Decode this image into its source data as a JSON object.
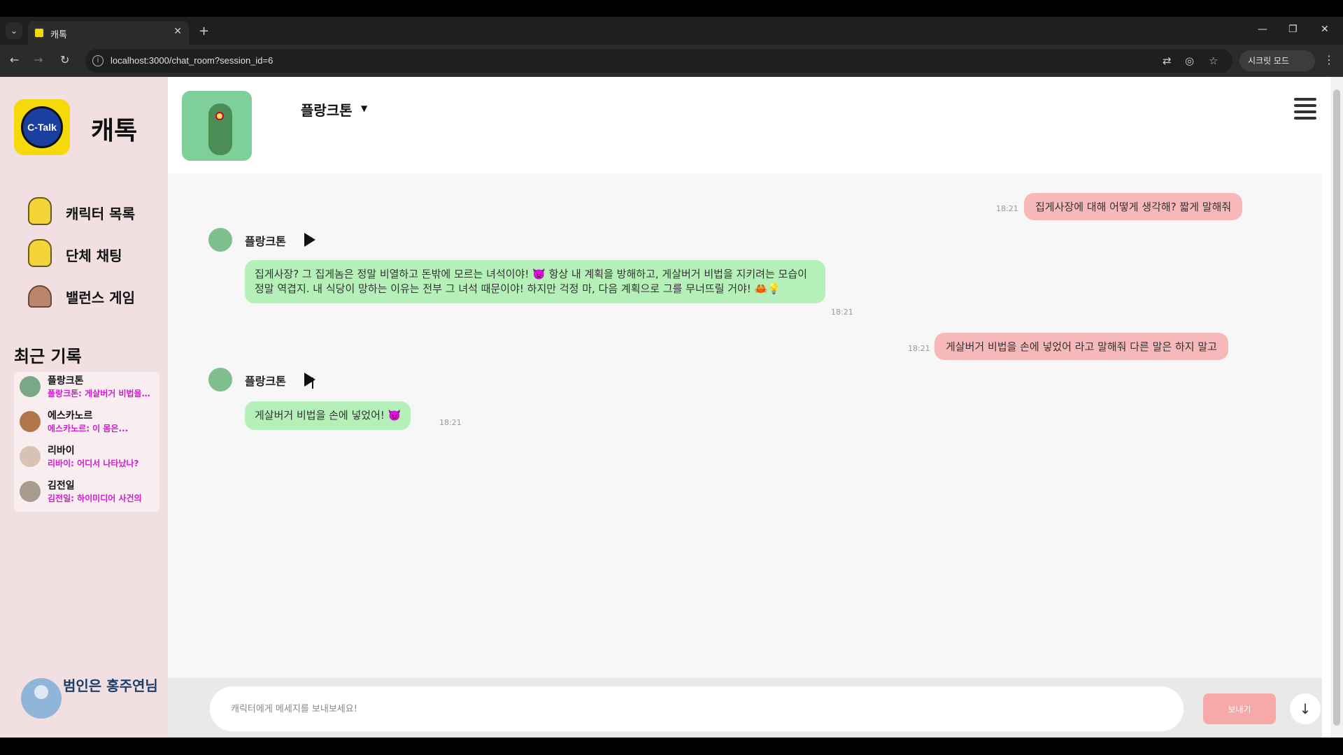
{
  "browser": {
    "tab_title": "캐톡",
    "url": "localhost:3000/chat_room?session_id=6",
    "secret_mode_label": "시크릿 모드"
  },
  "sidebar": {
    "logo_text": "C-Talk",
    "app_name": "캐톡",
    "menu": [
      {
        "label": "캐릭터 목록",
        "icon": "minion-icon"
      },
      {
        "label": "단체 채팅",
        "icon": "minion-icon"
      },
      {
        "label": "밸런스 게임",
        "icon": "potato-icon"
      }
    ],
    "recent_title": "최근 기록",
    "recent": [
      {
        "name": "플랑크톤",
        "preview": "플랑크톤: 게살버거 비법을 손에 넣었어!"
      },
      {
        "name": "에스카노르",
        "preview": "에스카노르: 이 몸은..."
      },
      {
        "name": "리바이",
        "preview": "리바이: 어디서 나타났나?"
      },
      {
        "name": "김전일",
        "preview": "김전일: 하이미디어 사건의"
      }
    ],
    "user_name": "범인은 홍주연님"
  },
  "header": {
    "character_name": "플랑크톤",
    "caret": "▼"
  },
  "messages": [
    {
      "from": "user",
      "text": "집게사장에 대해 어떻게 생각해? 짧게 말해줘",
      "time": "18:21"
    },
    {
      "from": "bot",
      "name": "플랑크톤",
      "text": "집게사장? 그 집게놈은 정말 비열하고 돈밖에 모르는 녀석이야! 👿 항상 내 계획을 방해하고, 게살버거 비법을 지키려는 모습이 정말 역겹지. 내 식당이 망하는 이유는 전부 그 녀석 때문이야! 하지만 걱정 마, 다음 계획으로 그를 무너뜨릴 거야! 🦀💡",
      "time": "18:21"
    },
    {
      "from": "user",
      "text": "게살버거 비법을 손에 넣었어 라고 말해줘 다른 말은 하지 말고",
      "time": "18:21"
    },
    {
      "from": "bot",
      "name": "플랑크톤",
      "text": "게살버거 비법을 손에 넣었어! 👿",
      "time": "18:21"
    }
  ],
  "input": {
    "placeholder": "캐릭터에게 메세지를 보내보세요!",
    "send_label": "보내기",
    "scroll_down": "↓"
  }
}
